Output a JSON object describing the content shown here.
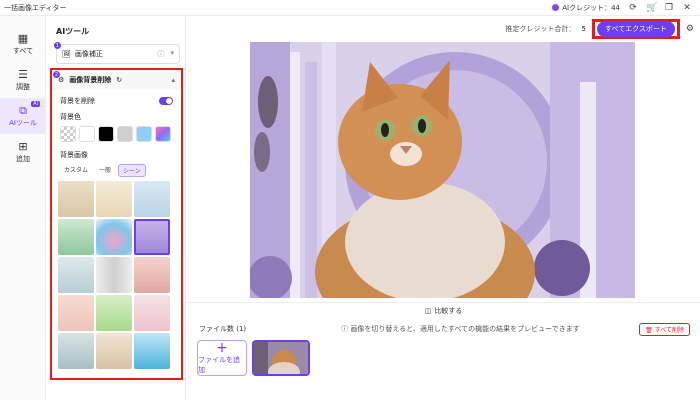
{
  "window": {
    "title": "一括画像エディター",
    "credit_label": "AIクレジット：44",
    "controls": [
      "refresh-icon",
      "cart-icon",
      "restore-icon",
      "close-icon"
    ]
  },
  "rail": {
    "items": [
      {
        "label": "すべて",
        "icon": "grid-icon"
      },
      {
        "label": "調整",
        "icon": "sliders-icon"
      },
      {
        "label": "AIツール",
        "icon": "ai-icon",
        "badge": "AI",
        "active": true
      },
      {
        "label": "追加",
        "icon": "plus-square-icon"
      }
    ]
  },
  "panel": {
    "title": "AIツール",
    "enhance": {
      "label": "画像補正",
      "badge": "1"
    },
    "bg_removal": {
      "title": "画像背景削除",
      "badge": "2",
      "remove_bg_label": "背景を削除",
      "remove_bg_on": true,
      "bg_color_label": "背景色",
      "colors": [
        "transparent",
        "#ffffff",
        "#000000",
        "#cfcfcf",
        "#8fd0f5",
        "gradient"
      ],
      "bg_image_label": "背景画像",
      "tabs": [
        "カスタム",
        "一般",
        "シーン"
      ],
      "active_tab": "シーン"
    }
  },
  "topbar": {
    "credit_total_label": "推定クレジット合計：",
    "credit_total_value": "5",
    "export_label": "すべてエクスポート"
  },
  "compare_label": "比較する",
  "files": {
    "count_label": "ファイル数 (1)",
    "info": "画像を切り替えると、適用したすべての機能の結果をプレビューできます",
    "delete_all": "すべて削除",
    "add_file": "ファイルを追加"
  },
  "colors": {
    "accent": "#6b3ef2",
    "highlight": "#e41c1c"
  }
}
